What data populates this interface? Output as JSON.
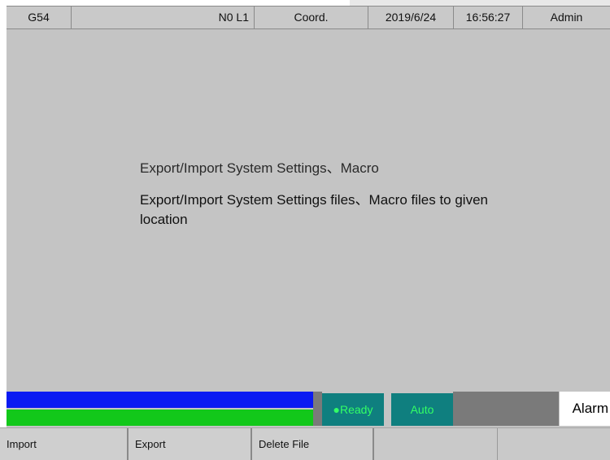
{
  "topbar": {
    "cells": [
      "G54",
      "N0 L1",
      "Coord.",
      "2019/6/24",
      "16:56:27",
      "Admin"
    ]
  },
  "content": {
    "title": "Export/Import System Settings、Macro",
    "description": "Export/Import System Settings files、Macro files to given location"
  },
  "status": {
    "ready": "●Ready",
    "mode": "Auto",
    "alarm": "Alarm"
  },
  "softkeys": [
    "Import",
    "Export",
    "Delete File",
    "",
    ""
  ]
}
